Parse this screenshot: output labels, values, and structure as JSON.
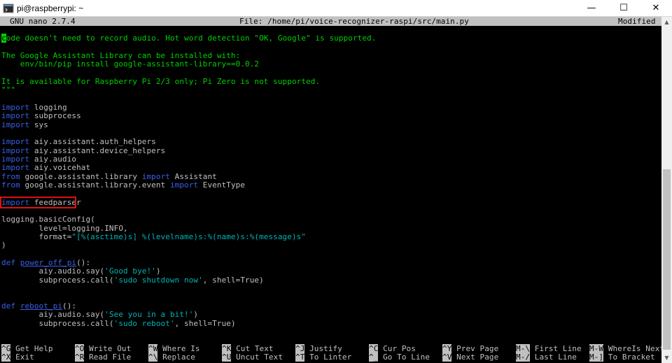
{
  "window": {
    "title": "pi@raspberrypi: ~",
    "minimize": "—",
    "maximize": "☐",
    "close": "✕"
  },
  "nano_header": {
    "version": "GNU nano 2.7.4",
    "file": "File: /home/pi/voice-recognizer-raspi/src/main.py",
    "status": "Modified"
  },
  "code_lines": [
    "code doesn't need to record audio. Hot word detection \"OK, Google\" is supported.",
    "",
    "The Google Assistant Library can be installed with:",
    "    env/bin/pip install google-assistant-library==0.0.2",
    "",
    "It is available for Raspberry Pi 2/3 only; Pi Zero is not supported.",
    "\"\"\"",
    "",
    "import logging",
    "import subprocess",
    "import sys",
    "",
    "import aiy.assistant.auth_helpers",
    "import aiy.assistant.device_helpers",
    "import aiy.audio",
    "import aiy.voicehat",
    "from google.assistant.library import Assistant",
    "from google.assistant.library.event import EventType",
    "",
    "import feedparser",
    "",
    "logging.basicConfig(",
    "        level=logging.INFO,",
    "        format=\"[%(asctime)s] %(levelname)s:%(name)s:%(message)s\"",
    ")",
    "",
    "def power_off_pi():",
    "        aiy.audio.say('Good bye!')",
    "        subprocess.call('sudo shutdown now', shell=True)",
    "",
    "",
    "def reboot_pi():",
    "        aiy.audio.say('See you in a bit!')",
    "        subprocess.call('sudo reboot', shell=True)"
  ],
  "shortcuts": [
    {
      "key": "^G",
      "label": "Get Help"
    },
    {
      "key": "^X",
      "label": "Exit"
    },
    {
      "key": "^O",
      "label": "Write Out"
    },
    {
      "key": "^R",
      "label": "Read File"
    },
    {
      "key": "^W",
      "label": "Where Is"
    },
    {
      "key": "^\\",
      "label": "Replace"
    },
    {
      "key": "^K",
      "label": "Cut Text"
    },
    {
      "key": "^U",
      "label": "Uncut Text"
    },
    {
      "key": "^J",
      "label": "Justify"
    },
    {
      "key": "^T",
      "label": "To Linter"
    },
    {
      "key": "^C",
      "label": "Cur Pos"
    },
    {
      "key": "^_",
      "label": "Go To Line"
    },
    {
      "key": "^Y",
      "label": "Prev Page"
    },
    {
      "key": "^V",
      "label": "Next Page"
    },
    {
      "key": "M-\\",
      "label": "First Line"
    },
    {
      "key": "M-/",
      "label": "Last Line"
    },
    {
      "key": "M-W",
      "label": "WhereIs Next"
    },
    {
      "key": "M-]",
      "label": "To Bracket"
    }
  ],
  "colors": {
    "terminal_bg": "#000000",
    "comment": "#00cf00",
    "keyword": "#3a5fe8",
    "string": "#00b4b4",
    "text": "#c0c0c0",
    "highlight": "#e01010"
  },
  "icons": {
    "app": "terminal-icon"
  }
}
